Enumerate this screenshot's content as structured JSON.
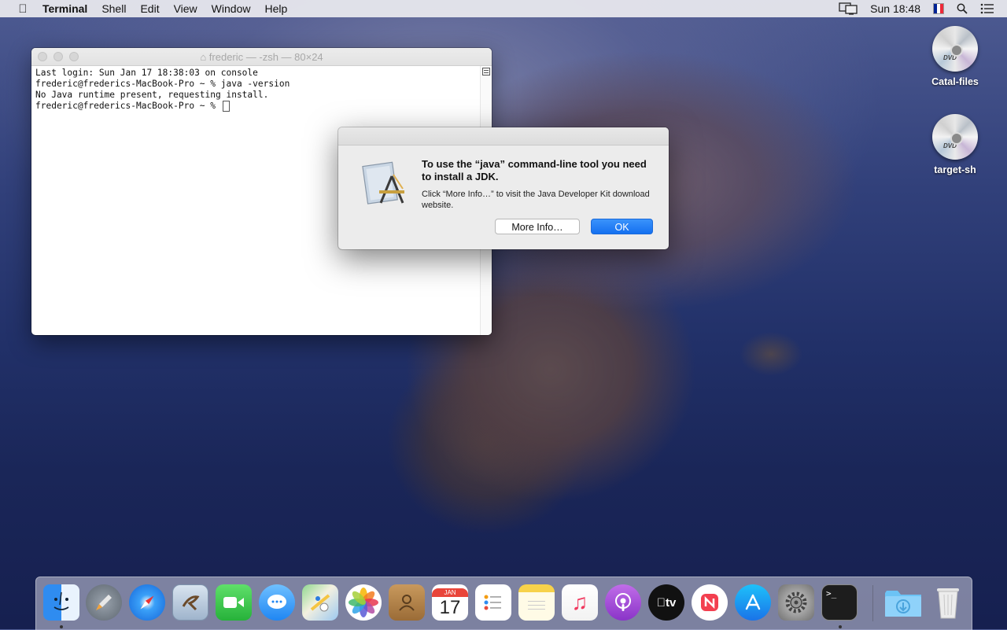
{
  "menubar": {
    "app_name": "Terminal",
    "menus": [
      "Shell",
      "Edit",
      "View",
      "Window",
      "Help"
    ],
    "clock": "Sun 18:48",
    "flag_colors": [
      "#002395",
      "#ffffff",
      "#ed2939"
    ]
  },
  "terminal": {
    "title": "frederic — -zsh — 80×24",
    "lines": [
      "Last login: Sun Jan 17 18:38:03 on console",
      "frederic@frederics-MacBook-Pro ~ % java -version",
      "No Java runtime present, requesting install.",
      "frederic@frederics-MacBook-Pro ~ % "
    ]
  },
  "dialog": {
    "title": "To use the “java” command-line tool you need to install a JDK.",
    "message": "Click “More Info…” to visit the Java Developer Kit download website.",
    "more_info_label": "More Info…",
    "ok_label": "OK"
  },
  "desktop": {
    "items": [
      {
        "label": "Catal-files",
        "disc_text": "DVD"
      },
      {
        "label": "target-sh",
        "disc_text": "DVD"
      }
    ]
  },
  "dock": {
    "calendar_month": "JAN",
    "calendar_day": "17",
    "tv_label": "tv",
    "terminal_prompt": ">_",
    "items": [
      "finder-icon",
      "launchpad-icon",
      "safari-icon",
      "mail-icon",
      "facetime-icon",
      "messages-icon",
      "maps-icon",
      "photos-icon",
      "contacts-icon",
      "calendar-icon",
      "reminders-icon",
      "notes-icon",
      "music-icon",
      "podcasts-icon",
      "tv-icon",
      "news-icon",
      "app-store-icon",
      "system-preferences-icon",
      "terminal-icon",
      "downloads-folder-icon",
      "trash-icon"
    ]
  }
}
